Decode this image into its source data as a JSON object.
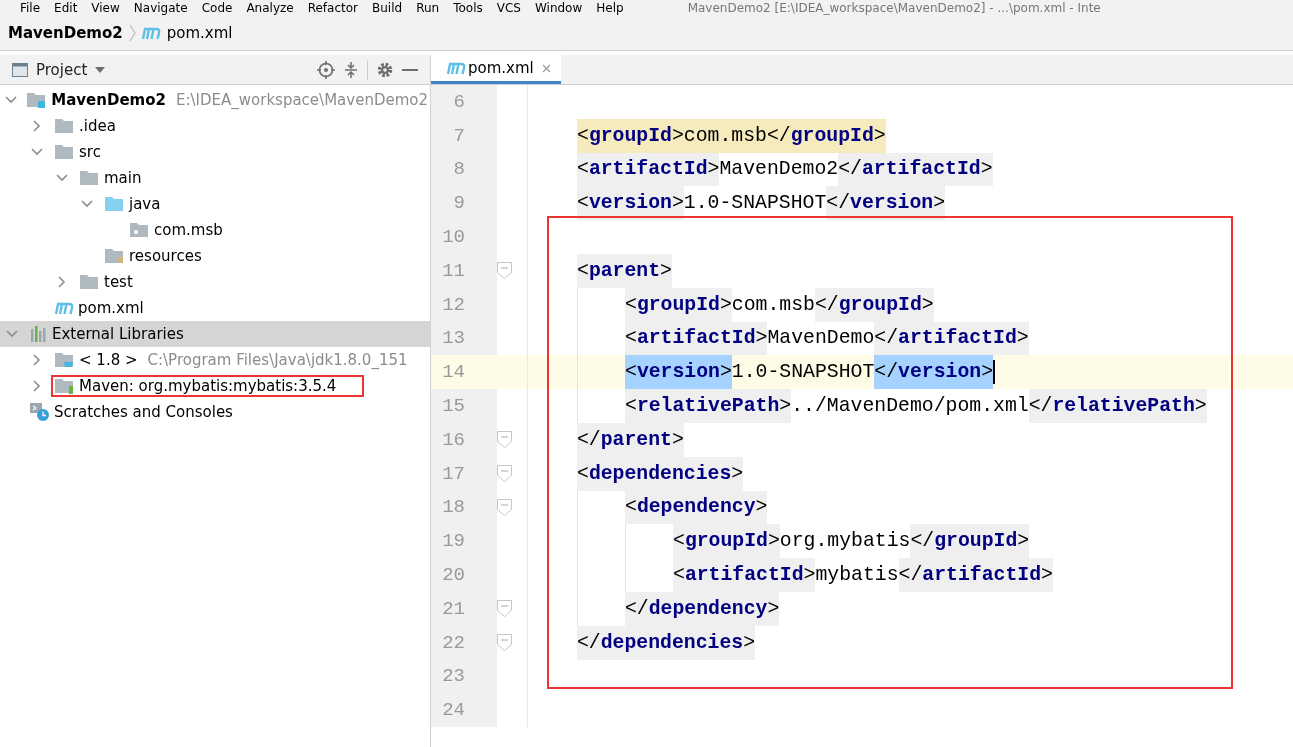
{
  "menu_bar": {
    "items": [
      "File",
      "Edit",
      "View",
      "Navigate",
      "Code",
      "Analyze",
      "Refactor",
      "Build",
      "Run",
      "Tools",
      "VCS",
      "Window",
      "Help"
    ],
    "title": "MavenDemo2 [E:\\IDEA_workspace\\MavenDemo2] - ...\\pom.xml - Inte"
  },
  "breadcrumb": [
    {
      "label": "MavenDemo2",
      "kind": "project"
    },
    {
      "label": "pom.xml",
      "kind": "maven"
    }
  ],
  "project_panel": {
    "title": "Project",
    "tree": [
      {
        "label": "MavenDemo2",
        "path": "E:\\IDEA_workspace\\MavenDemo2",
        "kind": "module",
        "expanded": true,
        "selected": false,
        "children": [
          {
            "label": ".idea",
            "kind": "folder",
            "expanded": false,
            "selected": false
          },
          {
            "label": "src",
            "kind": "folder",
            "expanded": true,
            "selected": false,
            "children": [
              {
                "label": "main",
                "kind": "folder",
                "expanded": true,
                "selected": false,
                "children": [
                  {
                    "label": "java",
                    "kind": "source",
                    "expanded": true,
                    "selected": false,
                    "children": [
                      {
                        "label": "com.msb",
                        "kind": "package",
                        "selected": false
                      }
                    ]
                  },
                  {
                    "label": "resources",
                    "kind": "resources",
                    "selected": false
                  }
                ]
              },
              {
                "label": "test",
                "kind": "folder",
                "expanded": false,
                "selected": false
              }
            ]
          },
          {
            "label": "pom.xml",
            "kind": "maven",
            "selected": false
          }
        ]
      },
      {
        "label": "External Libraries",
        "kind": "libraries",
        "expanded": true,
        "selected": true,
        "children": [
          {
            "label": "< 1.8 >",
            "path": "C:\\Program Files\\Java\\jdk1.8.0_151",
            "kind": "jdk",
            "expanded": false,
            "selected": false
          },
          {
            "label": "Maven: org.mybatis:mybatis:3.5.4",
            "kind": "library",
            "expanded": false,
            "selected": false,
            "annotated": true
          }
        ]
      },
      {
        "label": "Scratches and Consoles",
        "kind": "scratches",
        "selected": false
      }
    ]
  },
  "editor": {
    "tabs": [
      {
        "label": "pom.xml",
        "selected": true
      }
    ],
    "annotations": [
      {
        "kind": "frame"
      }
    ],
    "lines": [
      {
        "number": "6",
        "fold": false,
        "current": false
      },
      {
        "number": "7",
        "fold": false,
        "current": false,
        "match": true,
        "segments": [
          {
            "kind": "tag",
            "text": "<groupId>"
          },
          {
            "kind": "value",
            "text": "com.msb"
          },
          {
            "kind": "tag",
            "text": "</groupId>"
          }
        ]
      },
      {
        "number": "8",
        "fold": false,
        "current": false,
        "segments": [
          {
            "kind": "tag",
            "text": "<artifactId>"
          },
          {
            "kind": "value",
            "text": "MavenDemo2"
          },
          {
            "kind": "tag",
            "text": "</artifactId>"
          }
        ]
      },
      {
        "number": "9",
        "fold": false,
        "current": false,
        "segments": [
          {
            "kind": "tag",
            "text": "<version>"
          },
          {
            "kind": "value",
            "text": "1.0-SNAPSHOT"
          },
          {
            "kind": "tag",
            "text": "</version>"
          }
        ]
      },
      {
        "number": "10",
        "fold": false,
        "current": false
      },
      {
        "number": "11",
        "fold": true,
        "current": false,
        "segments": [
          {
            "kind": "tag",
            "text": "<parent>"
          }
        ],
        "children": [
          {
            "number": "12",
            "fold": false,
            "current": false,
            "segments": [
              {
                "kind": "tag",
                "text": "<groupId>"
              },
              {
                "kind": "value",
                "text": "com.msb"
              },
              {
                "kind": "tag",
                "text": "</groupId>"
              }
            ]
          },
          {
            "number": "13",
            "fold": false,
            "current": false,
            "segments": [
              {
                "kind": "tag",
                "text": "<artifactId>"
              },
              {
                "kind": "value",
                "text": "MavenDemo"
              },
              {
                "kind": "tag",
                "text": "</artifactId>"
              }
            ]
          },
          {
            "number": "14",
            "fold": false,
            "current": true,
            "segments": [
              {
                "kind": "tag",
                "text": "<version>",
                "selected": true
              },
              {
                "kind": "value",
                "text": "1.0-SNAPSHOT"
              },
              {
                "kind": "tag",
                "text": "</version>",
                "selected": true
              }
            ]
          },
          {
            "number": "15",
            "fold": false,
            "current": false,
            "segments": [
              {
                "kind": "tag",
                "text": "<relativePath>"
              },
              {
                "kind": "value",
                "text": "../MavenDemo/pom.xml"
              },
              {
                "kind": "tag",
                "text": "</relativePath>"
              }
            ]
          }
        ]
      },
      {
        "number": "16",
        "fold": true,
        "current": false,
        "segments": [
          {
            "kind": "tag",
            "text": "</parent>"
          }
        ]
      },
      {
        "number": "17",
        "fold": true,
        "current": false,
        "segments": [
          {
            "kind": "tag",
            "text": "<dependencies>"
          }
        ],
        "children": [
          {
            "number": "18",
            "fold": true,
            "current": false,
            "segments": [
              {
                "kind": "tag",
                "text": "<dependency>"
              }
            ],
            "children": [
              {
                "number": "19",
                "fold": false,
                "current": false,
                "segments": [
                  {
                    "kind": "tag",
                    "text": "<groupId>"
                  },
                  {
                    "kind": "value",
                    "text": "org.mybatis"
                  },
                  {
                    "kind": "tag",
                    "text": "</groupId>"
                  }
                ]
              },
              {
                "number": "20",
                "fold": false,
                "current": false,
                "segments": [
                  {
                    "kind": "tag",
                    "text": "<artifactId>"
                  },
                  {
                    "kind": "value",
                    "text": "mybatis"
                  },
                  {
                    "kind": "tag",
                    "text": "</artifactId>"
                  }
                ]
              }
            ]
          },
          {
            "number": "21",
            "fold": true,
            "current": false,
            "segments": [
              {
                "kind": "tag",
                "text": "</dependency>"
              }
            ]
          }
        ]
      },
      {
        "number": "22",
        "fold": true,
        "current": false,
        "segments": [
          {
            "kind": "tag",
            "text": "</dependencies>"
          }
        ]
      },
      {
        "number": "23",
        "fold": false,
        "current": false
      },
      {
        "number": "24",
        "fold": false,
        "current": false
      }
    ]
  }
}
